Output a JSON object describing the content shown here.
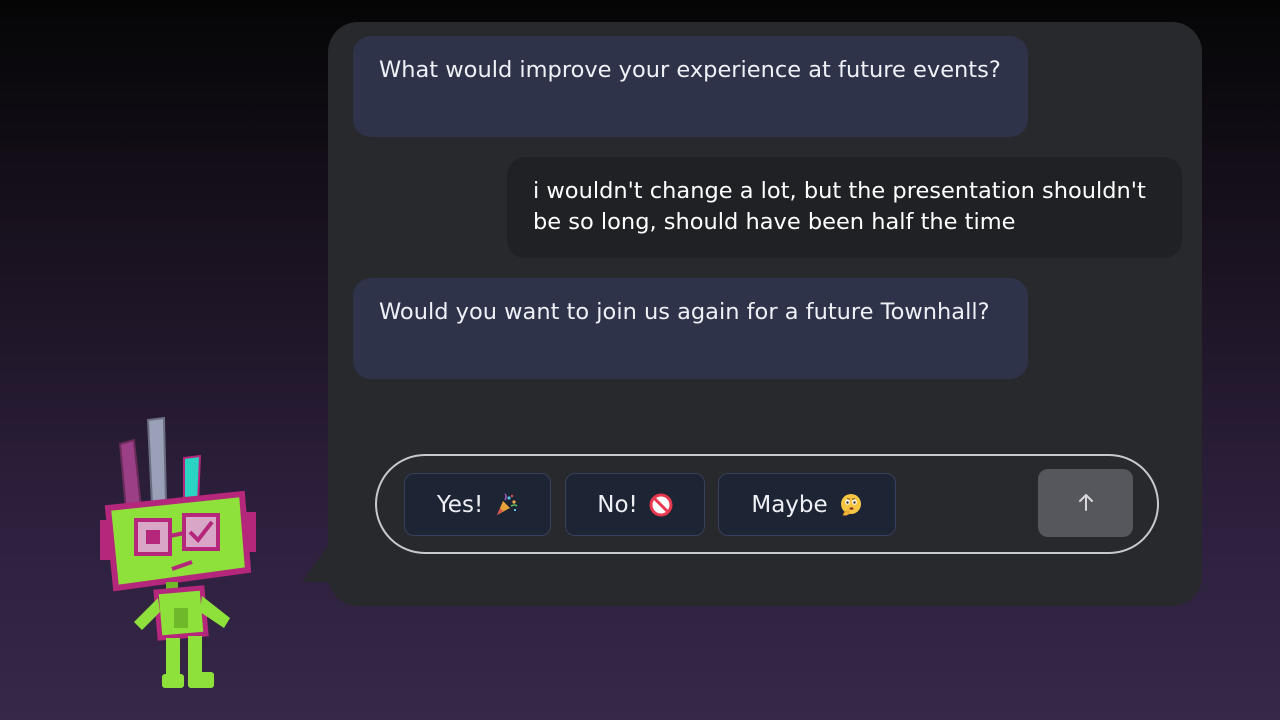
{
  "conversation": {
    "messages": [
      {
        "role": "bot",
        "text": "What would improve your experience at future events?"
      },
      {
        "role": "user",
        "text": "i wouldn't change a lot, but the presentation shouldn't be so long, should have been half the time"
      },
      {
        "role": "bot",
        "text": "Would you want to join us again for a future Townhall?"
      }
    ]
  },
  "quick_replies": [
    {
      "label": "Yes!",
      "icon": "party-popper-icon"
    },
    {
      "label": "No!",
      "icon": "prohibited-icon"
    },
    {
      "label": "Maybe",
      "icon": "thinking-face-icon"
    }
  ],
  "send": {
    "icon": "arrow-up-icon"
  },
  "mascot": {
    "icon": "robot-mascot"
  },
  "colors": {
    "window_bg": "#28292d",
    "bot_bubble": "#2f3349",
    "user_bubble": "#1f2124",
    "option_bg": "#1d2433",
    "send_bg": "#56575c",
    "mascot_green": "#8ee13a",
    "mascot_magenta": "#b4277a"
  }
}
